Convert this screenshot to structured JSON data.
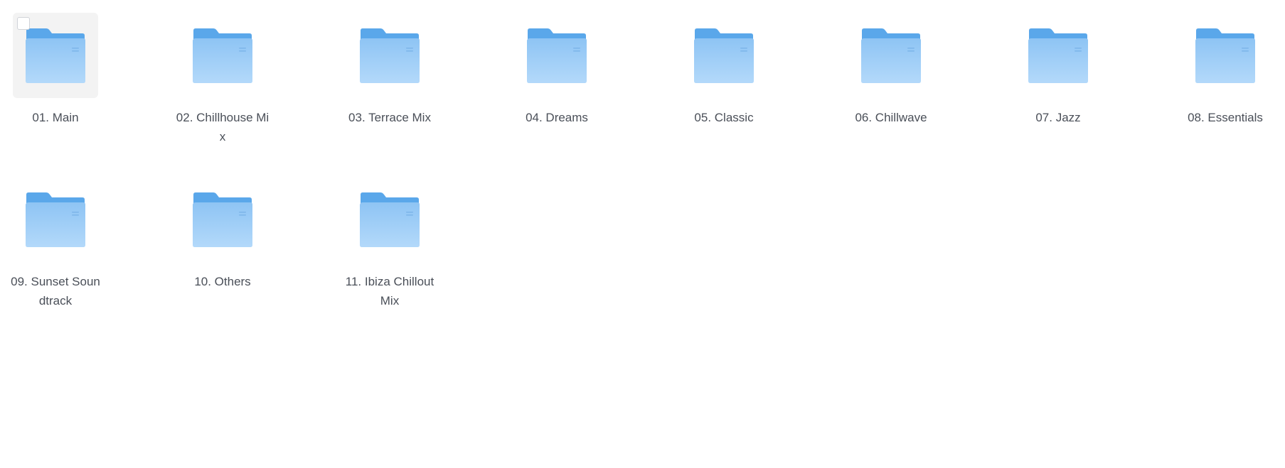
{
  "folders": [
    {
      "label": "01. Main",
      "selected": true
    },
    {
      "label": "02. Chillhouse Mix",
      "selected": false
    },
    {
      "label": "03. Terrace Mix",
      "selected": false
    },
    {
      "label": "04. Dreams",
      "selected": false
    },
    {
      "label": "05. Classic",
      "selected": false
    },
    {
      "label": "06. Chillwave",
      "selected": false
    },
    {
      "label": "07. Jazz",
      "selected": false
    },
    {
      "label": "08. Essentials",
      "selected": false
    },
    {
      "label": "09. Sunset Soundtrack",
      "selected": false
    },
    {
      "label": "10. Others",
      "selected": false
    },
    {
      "label": "11. Ibiza Chillout Mix",
      "selected": false
    }
  ],
  "icon": "folder-icon",
  "colors": {
    "folder_back": "#5aa7ea",
    "folder_front_top": "#8ec4f4",
    "folder_front_bottom": "#b3d9fa",
    "label": "#4a4f58",
    "selection_bg": "#f3f3f3"
  }
}
